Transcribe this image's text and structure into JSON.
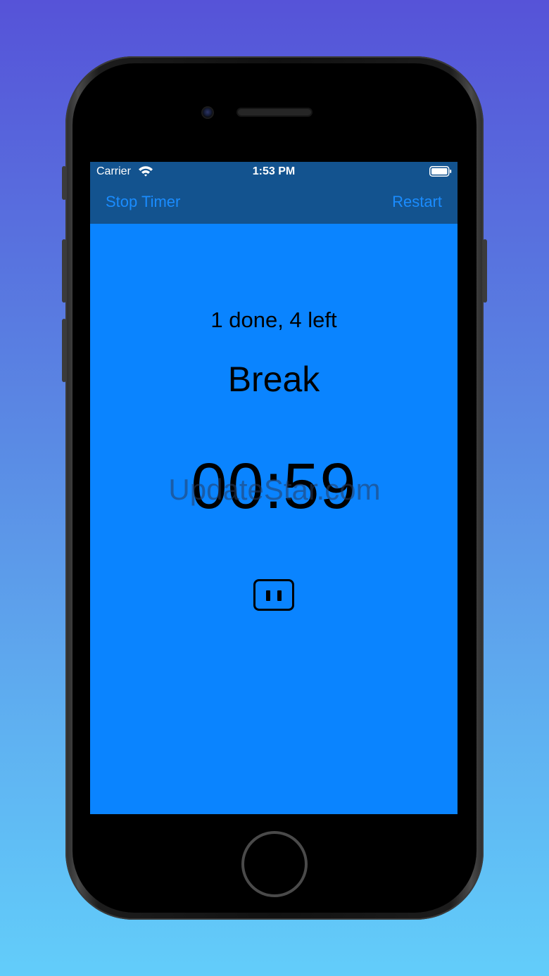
{
  "status_bar": {
    "carrier": "Carrier",
    "time": "1:53 PM",
    "icons": [
      "wifi-icon",
      "battery-icon"
    ]
  },
  "navbar": {
    "left_button": "Stop Timer",
    "right_button": "Restart"
  },
  "main": {
    "progress": "1 done, 4 left",
    "phase": "Break",
    "countdown": "00:59",
    "pause_icon": "pause-icon"
  },
  "watermark": "UpdateStar.com",
  "colors": {
    "screen_background": "#0a84ff",
    "navbar_background": "#13538f",
    "nav_button_text": "#1a8cff"
  }
}
